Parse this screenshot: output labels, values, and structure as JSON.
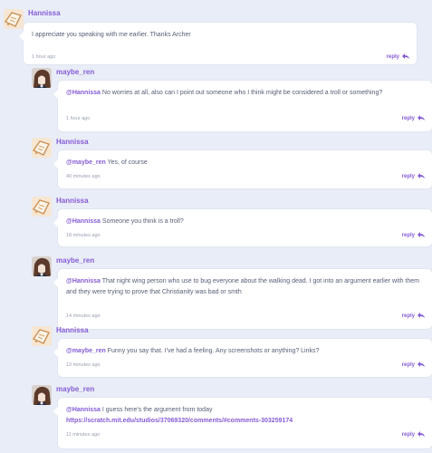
{
  "comments": [
    {
      "author": "Hannissa",
      "mention": "",
      "text": "I appreciate you speaking with me earlier. Thanks Archer",
      "link": "",
      "time": "1 hour ago",
      "reply": "reply",
      "avatar": "sticky-note-avatar"
    },
    {
      "author": "maybe_ren",
      "mention": "@Hannissa",
      "text": " No worries at all, also can I point out someone who I think might be considered a troll or something?",
      "link": "",
      "time": "1 hour ago",
      "reply": "reply",
      "avatar": "character-avatar"
    },
    {
      "author": "Hannissa",
      "mention": "@maybe_ren",
      "text": " Yes, of course",
      "link": "",
      "time": "40 minutes ago",
      "reply": "reply",
      "avatar": "sticky-note-avatar"
    },
    {
      "author": "Hannissa",
      "mention": "@Hannissa",
      "text": " Someone you think is a troll?",
      "link": "",
      "time": "18 minutes ago",
      "reply": "reply",
      "avatar": "sticky-note-avatar"
    },
    {
      "author": "maybe_ren",
      "mention": "@Hannissa",
      "text": " That night wing person who use to bug everyone about the walking dead. I got into an argument earlier with them and they were trying to prove that Christianity was bad or smth",
      "link": "",
      "time": "14 minutes ago",
      "reply": "reply",
      "avatar": "character-avatar"
    },
    {
      "author": "Hannissa",
      "mention": "@maybe_ren",
      "text": " Funny you say that. I've had a feeling. Any screenshots or anything? Links?",
      "link": "",
      "time": "13 minutes ago",
      "reply": "reply",
      "avatar": "sticky-note-avatar"
    },
    {
      "author": "maybe_ren",
      "mention": "@Hannissa",
      "text": " I guess here's the argument from today",
      "link": "https://scratch.mit.edu/studios/37069320/comments/#comments-303259174",
      "time": "11 minutes ago",
      "reply": "reply",
      "avatar": "character-avatar"
    }
  ],
  "colors": {
    "accent": "#855cd6",
    "background": "#e9edf7",
    "text": "#575e75"
  }
}
